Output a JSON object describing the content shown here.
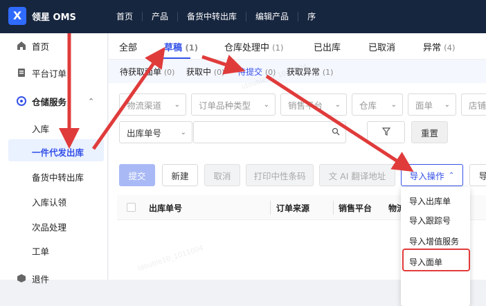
{
  "topbar": {
    "logo_glyph": "X",
    "brand": "领星 OMS",
    "nav": [
      "首页",
      "产品",
      "备货中转出库",
      "编辑产品",
      "序"
    ]
  },
  "sidebar": {
    "items": [
      {
        "label": "首页",
        "icon": "home-icon"
      },
      {
        "label": "平台订单",
        "icon": "clipboard-icon"
      },
      {
        "label": "仓储服务",
        "icon": "warehouse-icon"
      }
    ],
    "sub_items": [
      "入库",
      "一件代发出库",
      "备货中转出库",
      "入库认领",
      "次品处理",
      "工单"
    ],
    "bottom_item": {
      "label": "退件",
      "icon": "box-icon"
    }
  },
  "tabs": [
    {
      "label": "全部",
      "count": ""
    },
    {
      "label": "草稿",
      "count": "(1)"
    },
    {
      "label": "仓库处理中",
      "count": "(1)"
    },
    {
      "label": "已出库",
      "count": ""
    },
    {
      "label": "已取消",
      "count": ""
    },
    {
      "label": "异常",
      "count": "(4)"
    }
  ],
  "subtabs": [
    {
      "label": "待获取面单",
      "count": "(0)"
    },
    {
      "label": "获取中",
      "count": "(0)"
    },
    {
      "label": "待提交",
      "count": "(0)"
    },
    {
      "label": "获取异常",
      "count": "(1)"
    }
  ],
  "filters": [
    "物流渠道",
    "订单品种类型",
    "销售平台",
    "仓库",
    "面单",
    "店铺"
  ],
  "search": {
    "field": "出库单号",
    "placeholder": "",
    "reset": "重置"
  },
  "actions": {
    "submit": "提交",
    "new": "新建",
    "cancel": "取消",
    "print": "打印中性条码",
    "ai_translate": "AI 翻译地址",
    "import": "导入操作",
    "export": "导"
  },
  "table": {
    "columns": [
      "出库单号",
      "订单来源",
      "销售平台",
      "物流"
    ]
  },
  "import_menu": [
    "导入出库单",
    "导入跟踪号",
    "导入增值服务",
    "导入面单"
  ],
  "watermark": "idouble10_1011004",
  "colors": {
    "accent": "#3451e8",
    "annotation": "#e03b3b",
    "topbar": "#17263f"
  }
}
